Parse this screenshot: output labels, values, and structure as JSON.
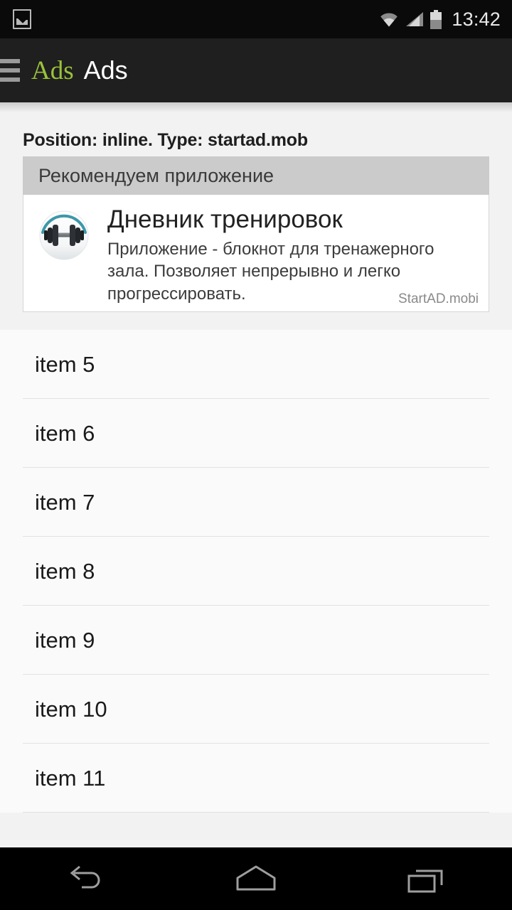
{
  "status_bar": {
    "icons": [
      "screenshot-icon",
      "wifi-icon",
      "signal-icon",
      "battery-icon"
    ],
    "time": "13:42",
    "background": "#0a0a0a",
    "foreground": "#c4c4c4"
  },
  "action_bar": {
    "menu_icon": "hamburger-icon",
    "logo_text": "Ads",
    "logo_color": "#9ac13c",
    "title": "Ads",
    "background": "#1f1f1f"
  },
  "content": {
    "position_label": "Position: inline. Type: startad.mob",
    "background": "#f2f2f2"
  },
  "ad": {
    "header": "Рекомендуем приложение",
    "header_background": "#cbcbcb",
    "icon_name": "dumbbell-app-icon",
    "app_name": "Дневник тренировок",
    "description": "Приложение - блокнот для тренажерного зала. Позволяет непрерывно и легко прогрессировать.",
    "attribution": "StartAD.mobi",
    "card_background": "#ffffff"
  },
  "list": {
    "items": [
      {
        "label": "item 5"
      },
      {
        "label": "item 6"
      },
      {
        "label": "item 7"
      },
      {
        "label": "item 8"
      },
      {
        "label": "item 9"
      },
      {
        "label": "item 10"
      },
      {
        "label": "item 11"
      }
    ]
  },
  "nav_bar": {
    "buttons": [
      {
        "name": "back-button",
        "icon": "back-arrow-icon"
      },
      {
        "name": "home-button",
        "icon": "home-icon"
      },
      {
        "name": "recents-button",
        "icon": "recents-icon"
      }
    ],
    "background": "#000000",
    "icon_color": "#9e9e9e"
  }
}
